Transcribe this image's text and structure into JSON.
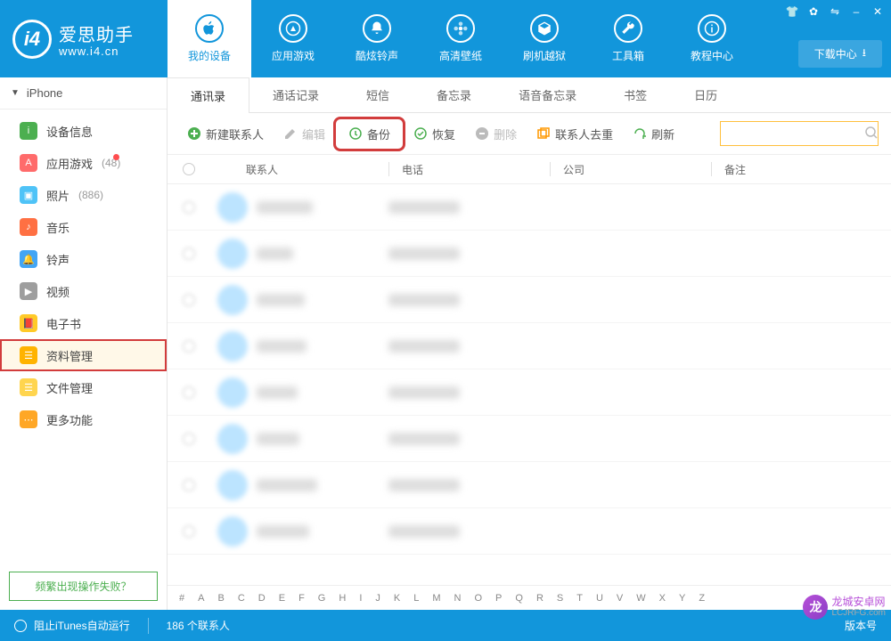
{
  "brand": {
    "title": "爱思助手",
    "subtitle": "www.i4.cn",
    "logo_letter": "i4"
  },
  "window_controls": {
    "shirt": "👕",
    "gear": "✿",
    "swap": "⇋",
    "min": "–",
    "close": "✕"
  },
  "download_center": "下载中心",
  "top_nav": [
    {
      "label": "我的设备",
      "icon": "apple",
      "active": true
    },
    {
      "label": "应用游戏",
      "icon": "appstore"
    },
    {
      "label": "酷炫铃声",
      "icon": "bell"
    },
    {
      "label": "高清壁纸",
      "icon": "flower"
    },
    {
      "label": "刷机越狱",
      "icon": "box"
    },
    {
      "label": "工具箱",
      "icon": "wrench"
    },
    {
      "label": "教程中心",
      "icon": "info"
    }
  ],
  "device_name": "iPhone",
  "sidebar": [
    {
      "label": "设备信息",
      "icon_bg": "#4caf50",
      "glyph": "i"
    },
    {
      "label": "应用游戏",
      "count": "(48)",
      "icon_bg": "#ff6b6b",
      "glyph": "A",
      "dot": true
    },
    {
      "label": "照片",
      "count": "(886)",
      "icon_bg": "#4fc3f7",
      "glyph": "▣"
    },
    {
      "label": "音乐",
      "icon_bg": "#ff7043",
      "glyph": "♪"
    },
    {
      "label": "铃声",
      "icon_bg": "#42a5f5",
      "glyph": "🔔"
    },
    {
      "label": "视频",
      "icon_bg": "#9e9e9e",
      "glyph": "▶"
    },
    {
      "label": "电子书",
      "icon_bg": "#ffca28",
      "glyph": "📕"
    },
    {
      "label": "资料管理",
      "icon_bg": "#ffb300",
      "glyph": "☰",
      "selected": true,
      "highlight": true
    },
    {
      "label": "文件管理",
      "icon_bg": "#ffd54f",
      "glyph": "☰"
    },
    {
      "label": "更多功能",
      "icon_bg": "#ffa726",
      "glyph": "⋯"
    }
  ],
  "help_text": "频繁出现操作失败？",
  "sub_tabs": [
    "通讯录",
    "通话记录",
    "短信",
    "备忘录",
    "语音备忘录",
    "书签",
    "日历"
  ],
  "active_sub_tab": 0,
  "toolbar": [
    {
      "label": "新建联系人",
      "color": "#4caf50",
      "icon": "plus"
    },
    {
      "label": "编辑",
      "disabled": true,
      "icon": "edit"
    },
    {
      "label": "备份",
      "color": "#4caf50",
      "icon": "backup",
      "highlight": true
    },
    {
      "label": "恢复",
      "color": "#4caf50",
      "icon": "restore"
    },
    {
      "label": "删除",
      "disabled": true,
      "icon": "delete"
    },
    {
      "label": "联系人去重",
      "color": "#ff9800",
      "icon": "dedup"
    },
    {
      "label": "刷新",
      "color": "#4caf50",
      "icon": "refresh"
    }
  ],
  "columns": {
    "contact": "联系人",
    "phone": "电话",
    "company": "公司",
    "remark": "备注"
  },
  "row_count": 8,
  "alpha": [
    "#",
    "A",
    "B",
    "C",
    "D",
    "E",
    "F",
    "G",
    "H",
    "I",
    "J",
    "K",
    "L",
    "M",
    "N",
    "O",
    "P",
    "Q",
    "R",
    "S",
    "T",
    "U",
    "V",
    "W",
    "X",
    "Y",
    "Z"
  ],
  "footer": {
    "itunes": "阻止iTunes自动运行",
    "count": "186 个联系人",
    "version": "版本号"
  },
  "watermark": {
    "big": "龙城安卓网",
    "small": "LCJRFG.com"
  }
}
